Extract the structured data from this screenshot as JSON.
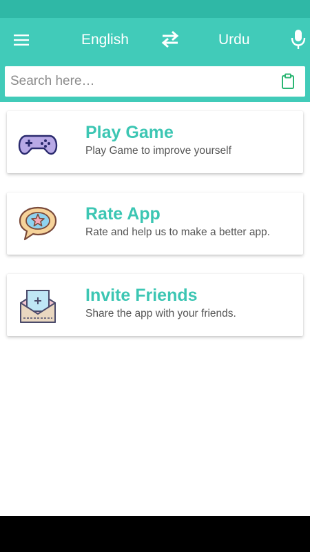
{
  "toolbar": {
    "source_language": "English",
    "target_language": "Urdu",
    "menu_icon": "menu-icon",
    "swap_icon": "swap-icon",
    "mic_icon": "microphone-icon"
  },
  "search": {
    "placeholder": "Search here…",
    "clipboard_icon": "clipboard-icon"
  },
  "cards": [
    {
      "title": "Play Game",
      "subtitle": "Play Game to improve yourself",
      "icon": "gamepad-icon"
    },
    {
      "title": "Rate App",
      "subtitle": "Rate and help us to make a better app.",
      "icon": "star-chat-bubble-icon"
    },
    {
      "title": "Invite Friends",
      "subtitle": "Share the app with your friends.",
      "icon": "envelope-invite-icon"
    }
  ],
  "colors": {
    "status_bar": "#2fb8a6",
    "toolbar": "#41cbb9",
    "accent_text": "#3cc6b3",
    "clipboard_icon": "#2bb673"
  }
}
